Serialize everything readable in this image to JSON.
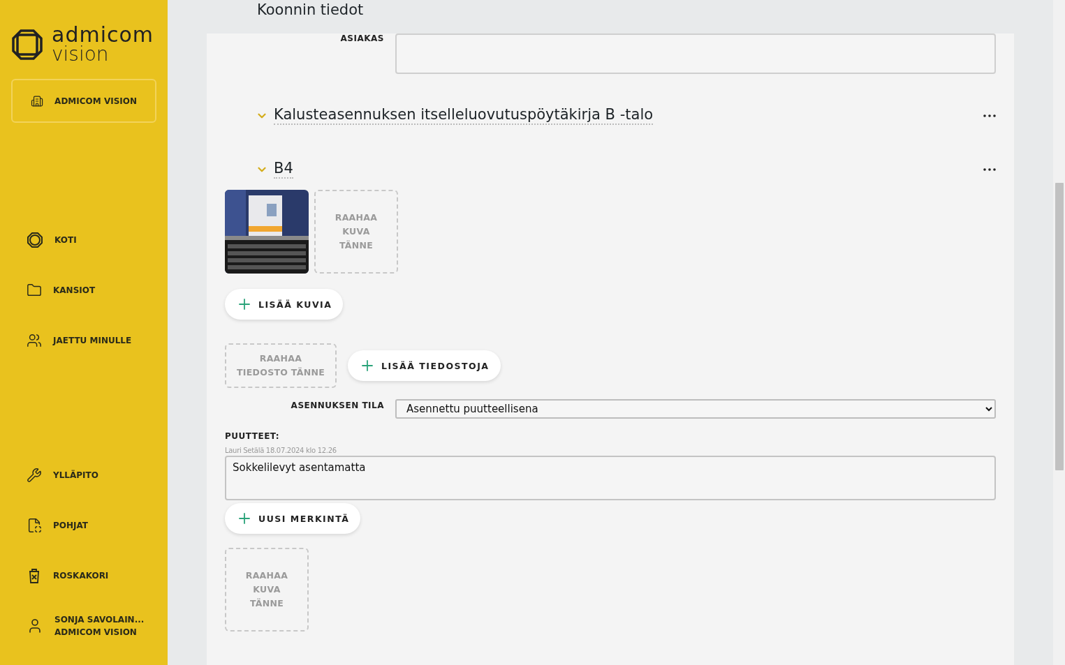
{
  "sidebar": {
    "logo": {
      "line1": "admicom",
      "line2": "vision"
    },
    "org_button": "ADMICOM VISION",
    "top_items": [
      {
        "kind": "home",
        "label": "KOTI"
      },
      {
        "kind": "folder",
        "label": "KANSIOT"
      },
      {
        "kind": "users",
        "label": "JAETTU MINULLE"
      }
    ],
    "bottom_items": [
      {
        "kind": "wrench",
        "label": "YLLÄPITO"
      },
      {
        "kind": "template",
        "label": "POHJAT"
      },
      {
        "kind": "trash",
        "label": "ROSKAKORI"
      }
    ],
    "user": {
      "name": "SONJA SAVOLAIN...",
      "org": "ADMICOM VISION"
    }
  },
  "header": {
    "title": "Koonnin tiedot"
  },
  "customer_field": {
    "label": "ASIAKAS"
  },
  "sections": [
    {
      "title": "Kalusteasennuksen itselleluovutuspöytäkirja B -talo",
      "expanded": true
    },
    {
      "title": "B4",
      "expanded": true
    }
  ],
  "photos": [
    {
      "kind": "picture"
    },
    {
      "kind": "dropzone",
      "text": "RAAHAA KUVA TÄNNE"
    }
  ],
  "add_photos_button": "LISÄÄ KUVIA",
  "file_dropzone": "RAAHAA TIEDOSTO TÄNNE",
  "add_files_button": "LISÄÄ TIEDOSTOJA",
  "status_field": {
    "label": "ASENNUKSEN TILA",
    "value": "Asennettu puutteellisena"
  },
  "defects": {
    "label": "PUUTTEET:",
    "meta": "Lauri Setälä 18.07.2024 klo 12.26",
    "text": "Sokkelilevyt asentamatta"
  },
  "new_entry_button": "UUSI MERKINTÄ",
  "defect_dropzone": "RAAHAA KUVA TÄNNE"
}
